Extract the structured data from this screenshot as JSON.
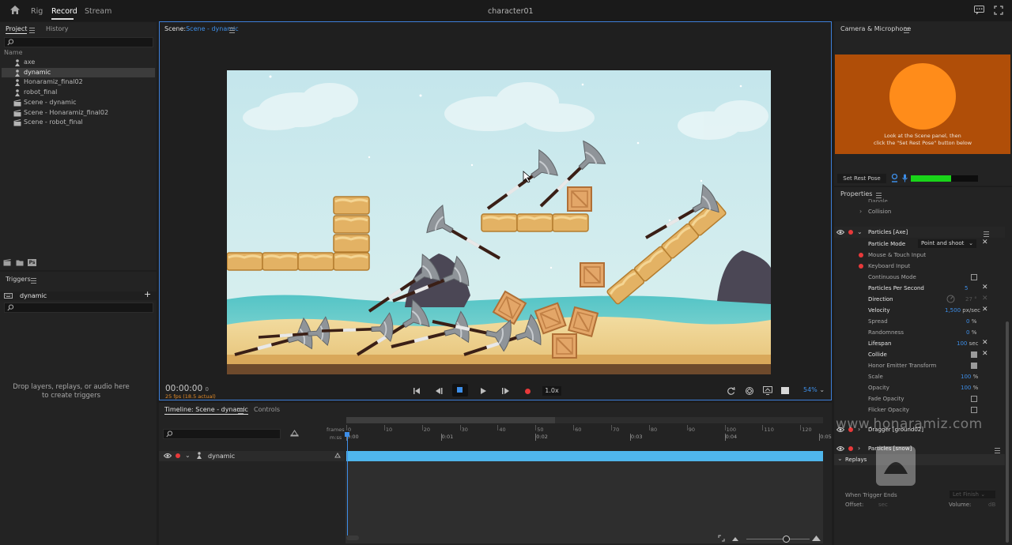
{
  "topbar": {
    "tabs": [
      "Rig",
      "Record",
      "Stream"
    ],
    "active_tab": "Record",
    "title": "character01"
  },
  "project": {
    "tab_project": "Project",
    "tab_history": "History",
    "col_name": "Name",
    "items": [
      {
        "name": "axe",
        "icon": "puppet-icon"
      },
      {
        "name": "dynamic",
        "icon": "puppet-icon",
        "selected": true
      },
      {
        "name": "Honaramiz_final02",
        "icon": "puppet-icon"
      },
      {
        "name": "robot_final",
        "icon": "puppet-icon"
      },
      {
        "name": "Scene - dynamic",
        "icon": "scene-icon"
      },
      {
        "name": "Scene - Honaramiz_final02",
        "icon": "scene-icon"
      },
      {
        "name": "Scene - robot_final",
        "icon": "scene-icon"
      }
    ],
    "footer_ps": "Ps"
  },
  "triggers": {
    "title": "Triggers",
    "puppet": "dynamic",
    "empty_line1": "Drop layers, replays, or audio here",
    "empty_line2": "to create triggers"
  },
  "scene": {
    "label": "Scene:",
    "name": "Scene - dynamic",
    "timecode": "00:00:00",
    "frame": "0",
    "fps": "25 fps (18.5 actual)",
    "speed": "1.0x",
    "zoom": "54%"
  },
  "timeline": {
    "tab_timeline": "Timeline: Scene - dynamic",
    "tab_controls": "Controls",
    "label_frames": "frames",
    "label_mss": "m:ss",
    "frame_ticks": [
      "0",
      "10",
      "20",
      "30",
      "40",
      "50",
      "60",
      "70",
      "80",
      "90",
      "100",
      "110",
      "120"
    ],
    "time_ticks": [
      "0:00",
      "0:01",
      "0:02",
      "0:03",
      "0:04",
      "0:05"
    ],
    "track": "dynamic"
  },
  "camera": {
    "title": "Camera & Microphone",
    "hint1": "Look at the Scene panel, then",
    "hint2": "click the \"Set Rest Pose\" button below",
    "rest_button": "Set Rest Pose",
    "level": 0.6,
    "accent": "#ff8c1a",
    "bg": "#b04e08"
  },
  "properties": {
    "title": "Properties",
    "cut": "Dangle",
    "collision": "Collision",
    "behavior": "Particles [Axe]",
    "mode_label": "Particle Mode",
    "mode_value": "Point and shoot",
    "mouse": "Mouse & Touch Input",
    "keyboard": "Keyboard Input",
    "continuous": "Continuous Mode",
    "pps_label": "Particles Per Second",
    "pps_value": "5",
    "direction_label": "Direction",
    "direction_value": "27 °",
    "velocity_label": "Velocity",
    "velocity_value": "1,500",
    "velocity_unit": "px/sec",
    "spread_label": "Spread",
    "spread_value": "0",
    "spread_unit": "%",
    "random_label": "Randomness",
    "random_value": "0",
    "random_unit": "%",
    "lifespan_label": "Lifespan",
    "lifespan_value": "100",
    "lifespan_unit": "sec",
    "collide": "Collide",
    "honor": "Honor Emitter Transform",
    "scale_label": "Scale",
    "scale_value": "100",
    "scale_unit": "%",
    "opacity_label": "Opacity",
    "opacity_value": "100",
    "opacity_unit": "%",
    "fade": "Fade Opacity",
    "flicker": "Flicker Opacity",
    "dragger": "Dragger [ground02]",
    "snow": "Particles [snow]",
    "replays": "Replays",
    "when_ends": "When Trigger Ends",
    "when_ends_value": "Let Finish",
    "offset": "Offset:",
    "offset_value": "sec",
    "volume": "Volume:",
    "volume_value": "dB"
  },
  "watermark": "www.honaramiz.com"
}
